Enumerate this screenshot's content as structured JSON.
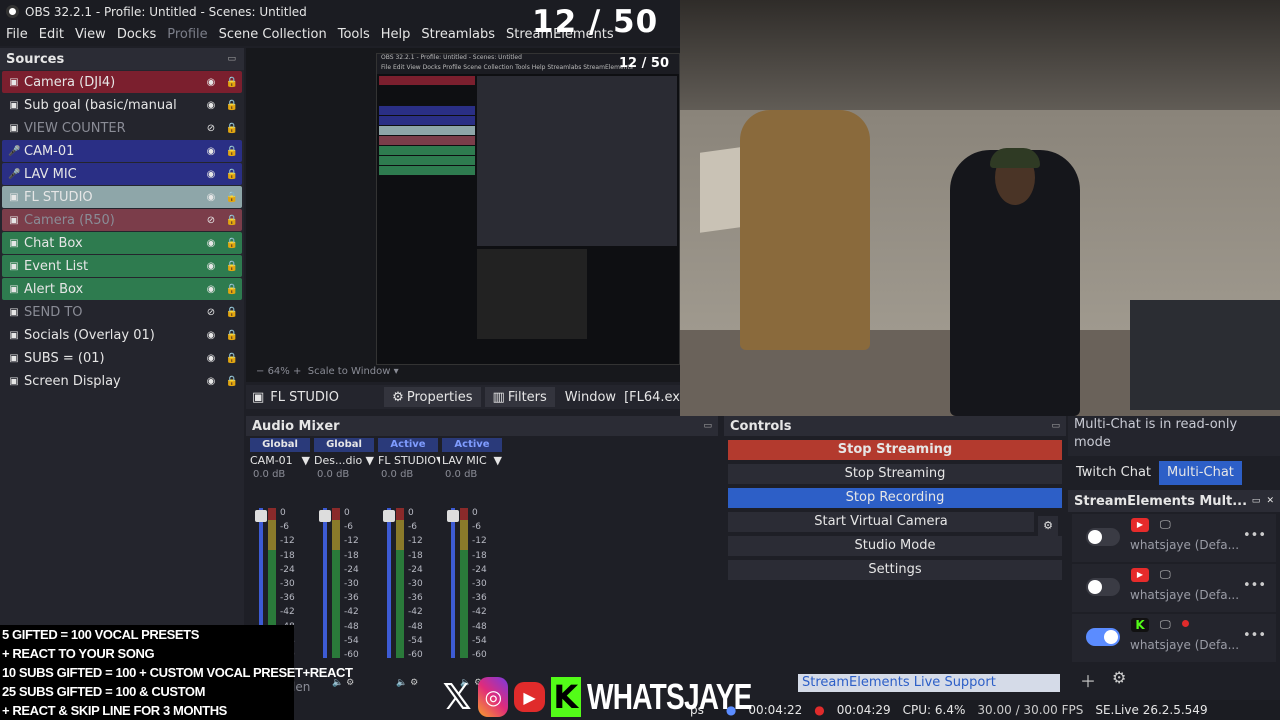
{
  "window": {
    "title": "OBS 32.2.1 - Profile: Untitled - Scenes: Untitled"
  },
  "menu": [
    "File",
    "Edit",
    "View",
    "Docks",
    "Profile",
    "Scene Collection",
    "Tools",
    "Help",
    "Streamlabs",
    "StreamElements"
  ],
  "overlay_counter": "12 / 50",
  "sources": {
    "title": "Sources",
    "items": [
      {
        "label": "Camera (DJI4)",
        "color": "red"
      },
      {
        "label": "Sub goal (basic/manual",
        "color": "none"
      },
      {
        "label": "VIEW COUNTER",
        "color": "none",
        "hidden": true
      },
      {
        "label": "CAM-01",
        "color": "blue"
      },
      {
        "label": "LAV MIC",
        "color": "blue"
      },
      {
        "label": "FL STUDIO",
        "color": "selected"
      },
      {
        "label": "Camera (R50)",
        "color": "redsel",
        "hidden": true
      },
      {
        "label": "Chat Box",
        "color": "green"
      },
      {
        "label": "Event List",
        "color": "green"
      },
      {
        "label": "Alert Box",
        "color": "green"
      },
      {
        "label": "SEND TO",
        "color": "none",
        "hidden": true
      },
      {
        "label": "Socials (Overlay 01)",
        "color": "none"
      },
      {
        "label": "SUBS = (01)",
        "color": "none"
      },
      {
        "label": "Screen Display",
        "color": "none"
      }
    ]
  },
  "preview": {
    "zoom": "64%",
    "zoom_label": "Scale to Window",
    "mini_title": "OBS 32.2.1 - Profile: Untitled - Scenes: Untitled",
    "mini_menu": "File Edit View Docks Profile Scene Collection Tools Help Streamlabs StreamElements"
  },
  "toolbar": {
    "source_name": "FL STUDIO",
    "properties": "Properties",
    "filters": "Filters",
    "window_label": "Window",
    "window_value": "[FL64.ex"
  },
  "mixer": {
    "title": "Audio Mixer",
    "channels": [
      {
        "tag": "Global",
        "name": "CAM-01",
        "db": "0.0 dB"
      },
      {
        "tag": "Global",
        "name": "Des...dio",
        "db": "0.0 dB"
      },
      {
        "tag": "Active",
        "name": "FL STUDIO",
        "db": "0.0 dB"
      },
      {
        "tag": "Active",
        "name": "LAV MIC",
        "db": "0.0 dB"
      }
    ],
    "scale": [
      "0",
      "-6",
      "-12",
      "-18",
      "-24",
      "-30",
      "-36",
      "-42",
      "-48",
      "-54",
      "-60"
    ]
  },
  "controls": {
    "title": "Controls",
    "stop_streaming_primary": "Stop Streaming",
    "stop_streaming": "Stop Streaming",
    "stop_recording": "Stop Recording",
    "virtual_camera": "Start Virtual Camera",
    "studio_mode": "Studio Mode",
    "settings": "Settings"
  },
  "chat": {
    "readonly_notice": "Multi-Chat is in read-only mode",
    "tab_twitch": "Twitch Chat",
    "tab_multi": "Multi-Chat",
    "se_title": "StreamElements Mult...",
    "accounts": [
      {
        "platform": "youtube",
        "name": "whatsjaye (Defa...",
        "enabled": false
      },
      {
        "platform": "youtube",
        "name": "whatsjaye (Defa...",
        "enabled": false
      },
      {
        "platform": "kick",
        "name": "whatsjaye (Defa...",
        "enabled": true,
        "live": true
      }
    ]
  },
  "support_link": "StreamElements Live Support",
  "status": {
    "stream_time": "00:04:22",
    "rec_time": "00:04:29",
    "cpu": "CPU: 6.4%",
    "fps": "30.00 / 30.00 FPS",
    "version": "SE.Live 26.2.5.549",
    "fragment": "ps"
  },
  "gifts": [
    "5 GIFTED = 100 VOCAL PRESETS",
    "+ REACT TO YOUR SONG",
    "10 SUBS GIFTED = 100 + CUSTOM VOCAL PRESET+REACT",
    "25 SUBS GIFTED = 100 & CUSTOM",
    "+ REACT & SKIP LINE FOR 3 MONTHS"
  ],
  "brand": "WHATSJAYE",
  "overflow_fragment": "len",
  "colors": {
    "accent": "#2d5fc7",
    "stop": "#b33a2e",
    "kick": "#53fc18"
  }
}
